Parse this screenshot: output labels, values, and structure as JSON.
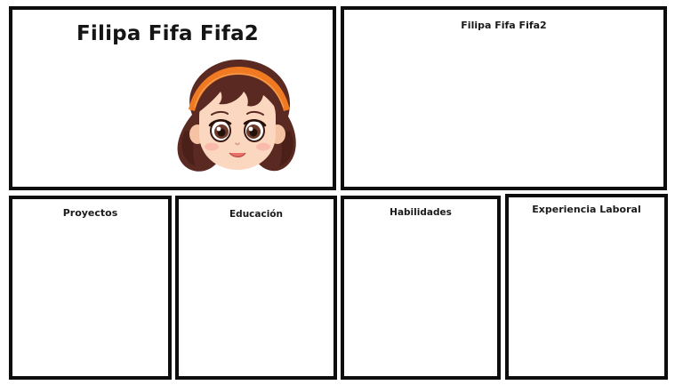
{
  "hero": {
    "title": "Filipa Fifa Fifa2",
    "avatar_icon": "girl-avatar-icon"
  },
  "about": {
    "title": "Filipa Fifa Fifa2"
  },
  "sections": {
    "proyectos": "Proyectos",
    "educacion": "Educación",
    "habilidades": "Habilidades",
    "experiencia": "Experiencia Laboral"
  },
  "colors": {
    "border": "#0d0d0d",
    "hair": "#5a2a22",
    "headband": "#f07a22",
    "skin": "#fcd7c0",
    "eye": "#6b3a2a"
  }
}
